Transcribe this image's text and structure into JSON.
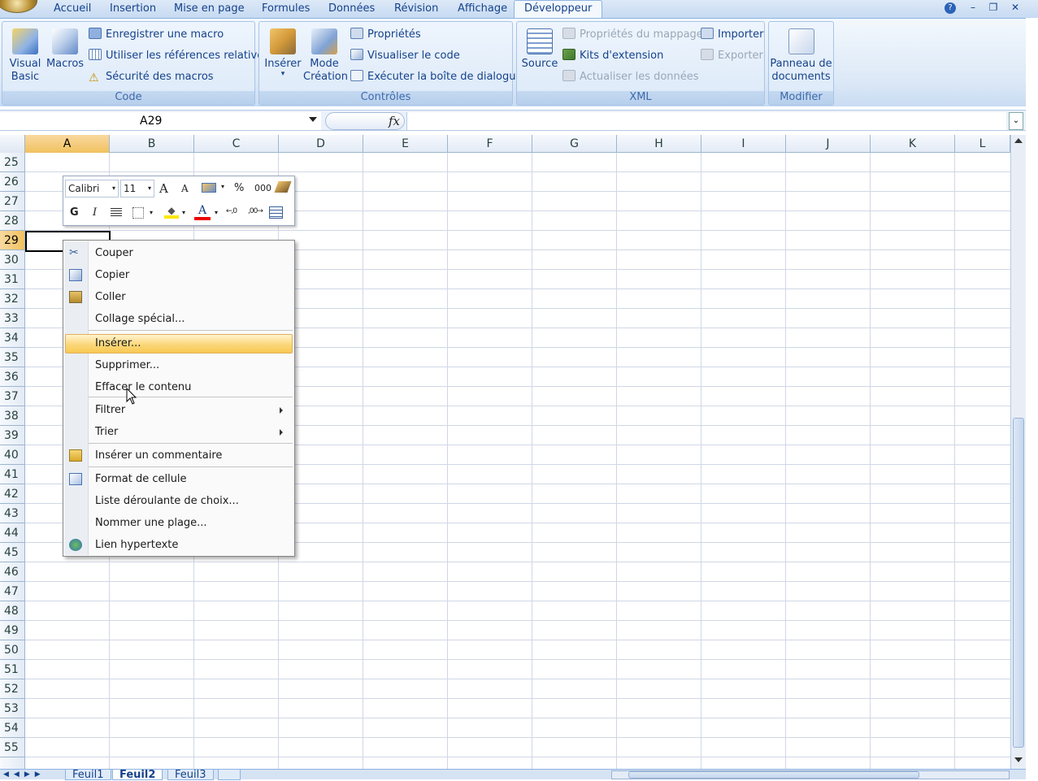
{
  "ribbon_tabs": [
    "Accueil",
    "Insertion",
    "Mise en page",
    "Formules",
    "Données",
    "Révision",
    "Affichage",
    "Développeur"
  ],
  "active_tab": "Développeur",
  "groups": {
    "code": {
      "label": "Code",
      "visual_basic": "Visual Basic",
      "visual_basic_l1": "Visual",
      "visual_basic_l2": "Basic",
      "macros": "Macros",
      "record": "Enregistrer une macro",
      "relative": "Utiliser les références relatives",
      "security": "Sécurité des macros"
    },
    "controls": {
      "label": "Contrôles",
      "insert": "Insérer",
      "design_l1": "Mode",
      "design_l2": "Création",
      "properties": "Propriétés",
      "view_code": "Visualiser le code",
      "run_dialog": "Exécuter la boîte de dialogue"
    },
    "xml": {
      "label": "XML",
      "source": "Source",
      "map_props": "Propriétés du mappage",
      "expansion": "Kits d'extension",
      "refresh": "Actualiser les données",
      "import": "Importer",
      "export": "Exporter"
    },
    "modify": {
      "label": "Modifier",
      "panel_l1": "Panneau de",
      "panel_l2": "documents"
    }
  },
  "formula_bar": {
    "name_box": "A29",
    "fx": "fx",
    "formula": ""
  },
  "columns": [
    "A",
    "B",
    "C",
    "D",
    "E",
    "F",
    "G",
    "H",
    "I",
    "J",
    "K",
    "L"
  ],
  "selected_column": "A",
  "rows": [
    "25",
    "26",
    "27",
    "28",
    "29",
    "30",
    "31",
    "32",
    "33",
    "34",
    "35",
    "36",
    "37",
    "38",
    "39",
    "40",
    "41",
    "42",
    "43",
    "44",
    "45",
    "46",
    "47",
    "48",
    "49",
    "50",
    "51",
    "52",
    "53",
    "54",
    "55"
  ],
  "selected_row": "29",
  "mini_toolbar": {
    "font": "Calibri",
    "size": "11",
    "grow": "A",
    "shrink": "A",
    "percent": "%",
    "thousands": "000",
    "bold": "G",
    "italic": "I",
    "font_color": "A"
  },
  "context_menu": [
    {
      "label": "Couper",
      "icon": "scissors-icon"
    },
    {
      "label": "Copier",
      "icon": "copy-icon"
    },
    {
      "label": "Coller",
      "icon": "paste-icon"
    },
    {
      "label": "Collage spécial...",
      "icon": ""
    },
    {
      "label": "Insérer...",
      "icon": "",
      "highlighted": true
    },
    {
      "label": "Supprimer...",
      "icon": ""
    },
    {
      "label": "Effacer le contenu",
      "icon": ""
    },
    {
      "label": "Filtrer",
      "icon": "",
      "submenu": true
    },
    {
      "label": "Trier",
      "icon": "",
      "submenu": true
    },
    {
      "label": "Insérer un commentaire",
      "icon": "comment-icon"
    },
    {
      "label": "Format de cellule",
      "icon": "format-cells-icon"
    },
    {
      "label": "Liste déroulante de choix...",
      "icon": ""
    },
    {
      "label": "Nommer une plage...",
      "icon": ""
    },
    {
      "label": "Lien hypertexte",
      "icon": "hyperlink-icon"
    }
  ],
  "sheet_tabs": [
    "Feuil1",
    "Feuil2",
    "Feuil3"
  ],
  "active_sheet": "Feuil2",
  "colors": {
    "accent": "#15428b",
    "ribbon": "#dde9f7",
    "highlight": "#fbd77a",
    "grid": "#d0d7e5"
  }
}
